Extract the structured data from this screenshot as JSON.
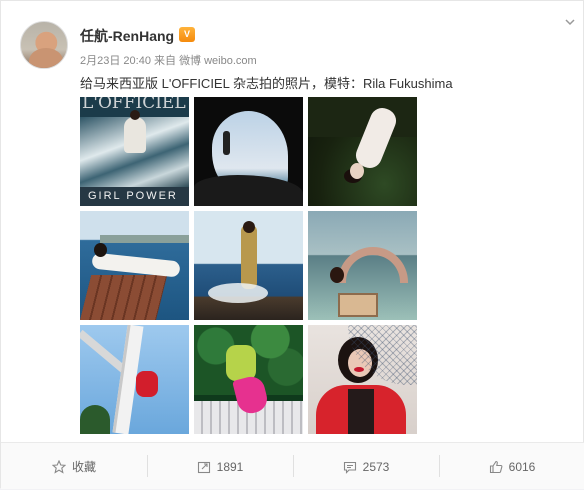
{
  "post": {
    "username": "任航-RenHang",
    "vip_badge": "V",
    "timestamp": "2月23日 20:40",
    "source_prefix": "来自",
    "source": "微博 weibo.com",
    "text": "给马来西亚版 L'OFFICIEL 杂志拍的照片，模特：Rila Fukushima"
  },
  "photos": {
    "p1_magazine_title": "L'OFFICIEL",
    "p1_caption": "GIRL POWER"
  },
  "actions": {
    "favorite_label": "收藏",
    "repost_count": "1891",
    "comment_count": "2573",
    "like_count": "6016"
  },
  "colors": {
    "text_primary": "#333333",
    "text_meta": "#888888",
    "vip_gradient_top": "#ffb33b",
    "vip_gradient_bottom": "#f58a0c"
  },
  "icons": [
    "chevron-down-icon",
    "star-icon",
    "repost-icon",
    "comment-icon",
    "like-icon"
  ]
}
